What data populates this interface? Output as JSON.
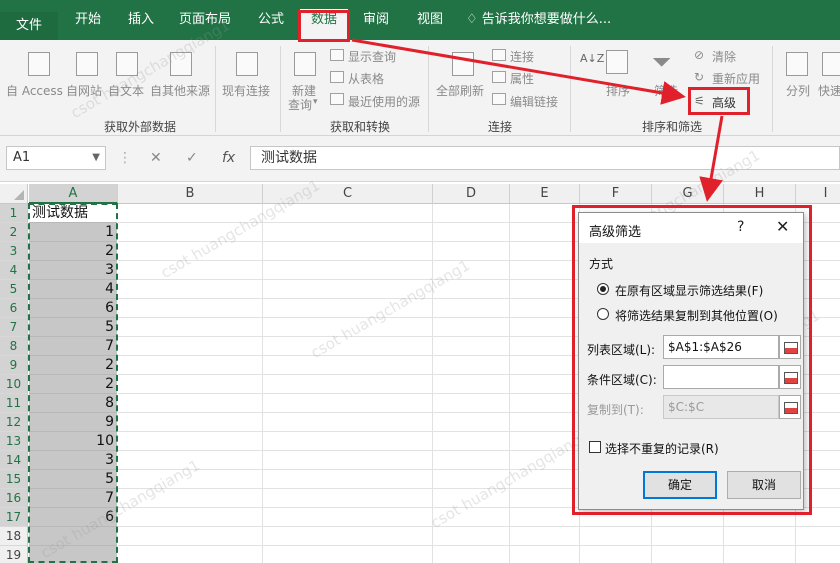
{
  "tabs": {
    "file": "文件",
    "home": "开始",
    "insert": "插入",
    "layout": "页面布局",
    "formulas": "公式",
    "data": "数据",
    "review": "审阅",
    "view": "视图",
    "tell": "告诉我你想要做什么..."
  },
  "ribbon": {
    "get_external": {
      "access": "自 Access",
      "web": "自网站",
      "text": "自文本",
      "other": "自其他来源",
      "existing": "现有连接",
      "group": "获取外部数据"
    },
    "get_transform": {
      "new_query_1": "新建",
      "new_query_2": "查询",
      "show_queries": "显示查询",
      "from_table": "从表格",
      "recent_sources": "最近使用的源",
      "group": "获取和转换"
    },
    "connections": {
      "refresh_all": "全部刷新",
      "connections": "连接",
      "properties": "属性",
      "edit_links": "编辑链接",
      "group": "连接"
    },
    "sort_filter": {
      "sort": "排序",
      "filter": "筛选",
      "clear": "清除",
      "reapply": "重新应用",
      "advanced": "高级",
      "group": "排序和筛选"
    },
    "tools": {
      "split": "分列",
      "quick": "快速"
    }
  },
  "formula_bar": {
    "name_box": "A1",
    "cancel": "✕",
    "enter": "✓",
    "fx": "fx",
    "content": "测试数据"
  },
  "columns": [
    "A",
    "B",
    "C",
    "D",
    "E",
    "F",
    "G",
    "H",
    "I"
  ],
  "rows": [
    "1",
    "2",
    "3",
    "4",
    "5",
    "6",
    "7",
    "8",
    "9",
    "10",
    "11",
    "12",
    "13",
    "14",
    "15",
    "16",
    "17",
    "18",
    "19"
  ],
  "column_a": [
    "测试数据",
    "1",
    "2",
    "3",
    "4",
    "6",
    "5",
    "7",
    "2",
    "2",
    "8",
    "9",
    "10",
    "3",
    "5",
    "7",
    "6",
    "",
    ""
  ],
  "dialog": {
    "title": "高级筛选",
    "help": "?",
    "close": "✕",
    "mode_label": "方式",
    "option_inplace": "在原有区域显示筛选结果(F)",
    "option_copy": "将筛选结果复制到其他位置(O)",
    "list_range_label": "列表区域(L):",
    "list_range_value": "$A$1:$A$26",
    "criteria_label": "条件区域(C):",
    "criteria_value": "",
    "copy_to_label": "复制到(T):",
    "copy_to_value": "$C:$C",
    "unique_label": "选择不重复的记录(R)",
    "ok": "确定",
    "cancel": "取消"
  },
  "watermark": "csot huangchangqiang1",
  "colors": {
    "ribbon_green": "#217346",
    "annotation_red": "#e0202a",
    "selection_gray": "#c7c7c7"
  }
}
